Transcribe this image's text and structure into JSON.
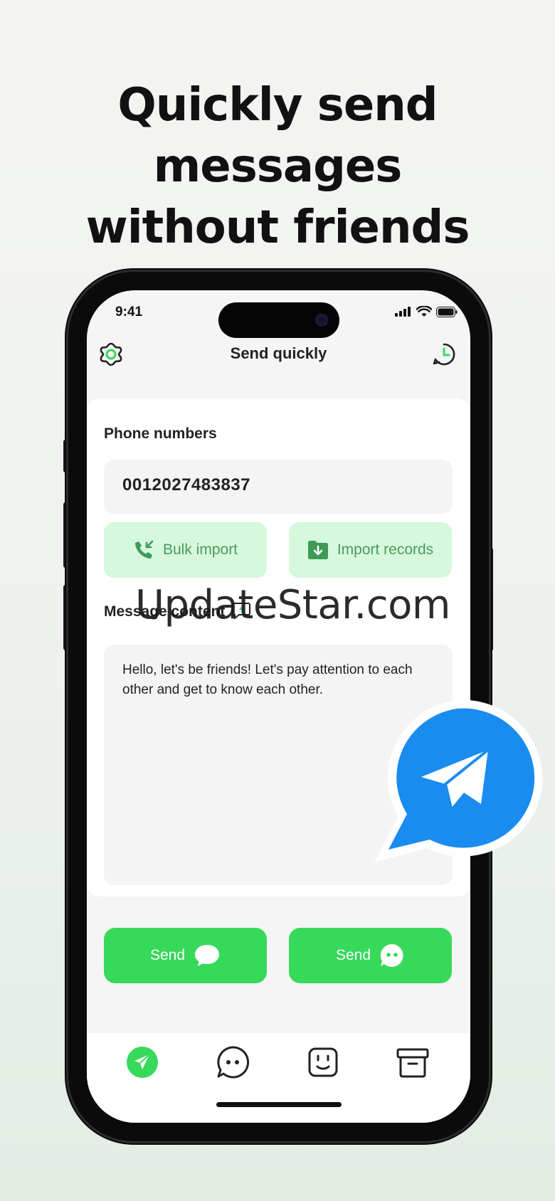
{
  "headline": {
    "line1": "Quickly send messages",
    "line2": "without friends"
  },
  "status_bar": {
    "time": "9:41"
  },
  "header": {
    "title": "Send quickly",
    "left_icon": "flower-settings-icon",
    "right_icon": "clock-history-icon"
  },
  "phone_section": {
    "label": "Phone numbers",
    "value": "0012027483837",
    "bulk_import_label": "Bulk import",
    "import_records_label": "Import records"
  },
  "message_section": {
    "label": "Message content",
    "value": "Hello, let's be friends! Let's pay attention to each other and get to know each other."
  },
  "actions": {
    "send_label_1": "Send",
    "send_label_2": "Send"
  },
  "tabs": [
    {
      "icon": "send-icon",
      "active": true
    },
    {
      "icon": "chat-bubble-icon",
      "active": false
    },
    {
      "icon": "smiley-face-icon",
      "active": false
    },
    {
      "icon": "archive-box-icon",
      "active": false
    }
  ],
  "watermark": "UpdateStar.com",
  "colors": {
    "accent_green": "#36d95a",
    "soft_green": "#d6f8dc",
    "soft_green_text": "#4b9b60",
    "telegram_blue": "#1a8cf0"
  }
}
